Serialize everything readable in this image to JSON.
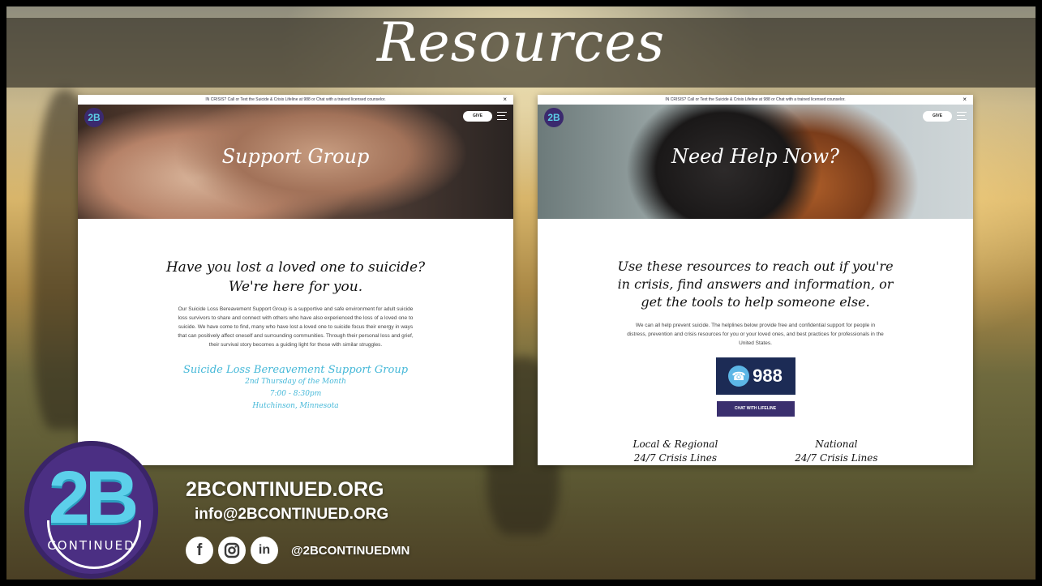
{
  "slide": {
    "title": "Resources"
  },
  "left_shot": {
    "crisis_text": "IN CRISIS? Call or Text the Suicide & Crisis Lifeline at 988 or Chat with a trained licensed counselor.",
    "close": "×",
    "logo": "2B",
    "give": "GIVE",
    "hero_title": "Support Group",
    "heading_1": "Have you lost a loved one to suicide?",
    "heading_2": "We're here for you.",
    "paragraph": "Our Suicide Loss Bereavement Support Group is a supportive and safe environment for adult suicide loss survivors to share and connect with others who have also experienced the loss of a loved one to suicide. We have come to find, many who have lost a loved one to suicide focus their energy in ways that can positively affect oneself and surrounding communities. Through their personal loss and grief, their survival story becomes a guiding light for those with similar struggles.",
    "group_title": "Suicide Loss Bereavement Support Group",
    "group_when": "2nd Thursday of the Month",
    "group_time": "7:00 - 8:30pm",
    "group_where": "Hutchinson, Minnesota"
  },
  "right_shot": {
    "crisis_text": "IN CRISIS? Call or Text the Suicide & Crisis Lifeline at 988 or Chat with a trained licensed counselor.",
    "close": "×",
    "logo": "2B",
    "give": "GIVE",
    "hero_title": "Need Help Now?",
    "heading_1": "Use these resources to reach out if you're",
    "heading_2": "in crisis, find answers and information, or",
    "heading_3": "get the tools to help someone else.",
    "paragraph": "We can all help prevent suicide. The helplines below provide free and confidential support for people in distress, prevention and crisis resources for you or your loved ones, and best practices for professionals in the United States.",
    "badge_number": "988",
    "chat_button": "CHAT WITH LIFELINE",
    "local_1": "Local & Regional",
    "local_2": "24/7 Crisis Lines",
    "national_1": "National",
    "national_2": "24/7 Crisis Lines"
  },
  "branding": {
    "logo_text": "2B",
    "logo_sub": "CONTINUED",
    "website": "2BCONTINUED.ORG",
    "email": "info@2BCONTINUED.ORG",
    "social_handle": "@2BCONTINUEDMN",
    "icons": [
      "facebook-icon",
      "instagram-icon",
      "linkedin-icon"
    ]
  }
}
